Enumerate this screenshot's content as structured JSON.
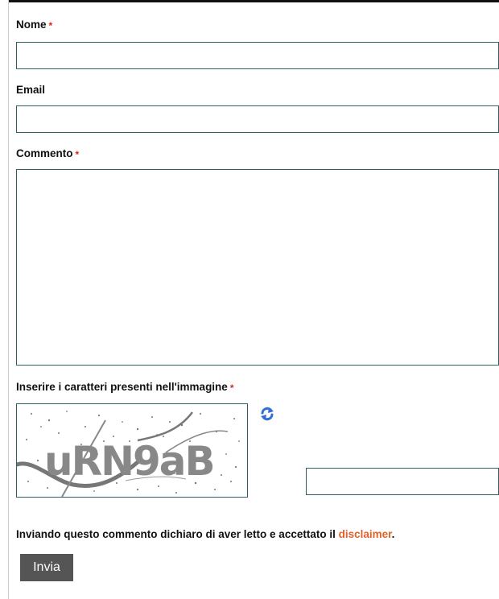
{
  "form": {
    "name": {
      "label": "Nome",
      "required_mark": "*",
      "value": ""
    },
    "email": {
      "label": "Email",
      "value": ""
    },
    "comment": {
      "label": "Commento",
      "required_mark": "*",
      "value": ""
    },
    "captcha": {
      "label": "Inserire i caratteri presenti nell'immagine",
      "required_mark": "*",
      "image_text": "uRN9aB",
      "refresh_icon": "refresh-icon",
      "value": ""
    },
    "disclaimer": {
      "text": "Inviando questo commento dichiaro di aver letto e accettato il ",
      "link_label": "disclaimer",
      "suffix": "."
    },
    "submit_label": "Invia"
  },
  "colors": {
    "required": "#d9261c",
    "link": "#e0622a",
    "border": "#2f5f63",
    "button_bg": "#555555",
    "refresh": "#2f6fd6"
  }
}
